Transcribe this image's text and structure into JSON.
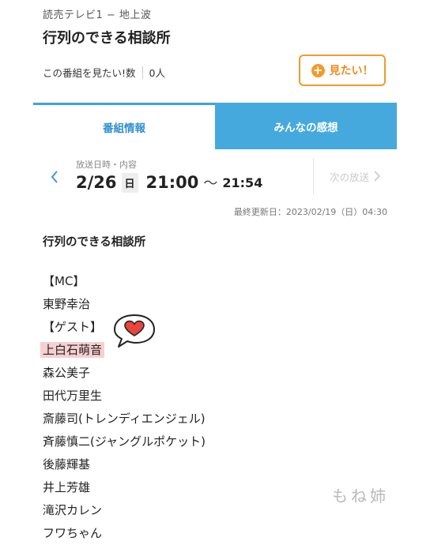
{
  "header": {
    "channel": "読売テレビ1 − 地上波",
    "title": "行列のできる相談所",
    "want_text": "この番組を見たい!数",
    "want_count": "0人",
    "want_button_label": "見たい！"
  },
  "tabs": [
    {
      "label": "番組情報",
      "active": true
    },
    {
      "label": "みんなの感想",
      "active": false
    }
  ],
  "broadcast": {
    "label": "放送日時・内容",
    "date": "2/26",
    "dow": "日",
    "start": "21:00",
    "separator": "〜",
    "end": "21:54",
    "next_label": "次の放送"
  },
  "updated": "最終更新日：2023/02/19（日）04:30",
  "program_name": "行列のできる相談所",
  "cast": [
    "【MC】",
    "東野幸治",
    "【ゲスト】",
    "上白石萌音",
    "森公美子",
    "田代万里生",
    "斎藤司(トレンディエンジェル)",
    "斉藤慎二(ジャングルポケット)",
    "後藤輝基",
    "井上芳雄",
    "滝沢カレン",
    "フワちゃん"
  ],
  "highlighted_cast_index": 3,
  "watermark": "もね姉",
  "colors": {
    "accent_blue": "#45a9de",
    "accent_orange": "#f39a2b",
    "highlight_pink": "#f8cfd0",
    "heart_red": "#e8453c"
  }
}
